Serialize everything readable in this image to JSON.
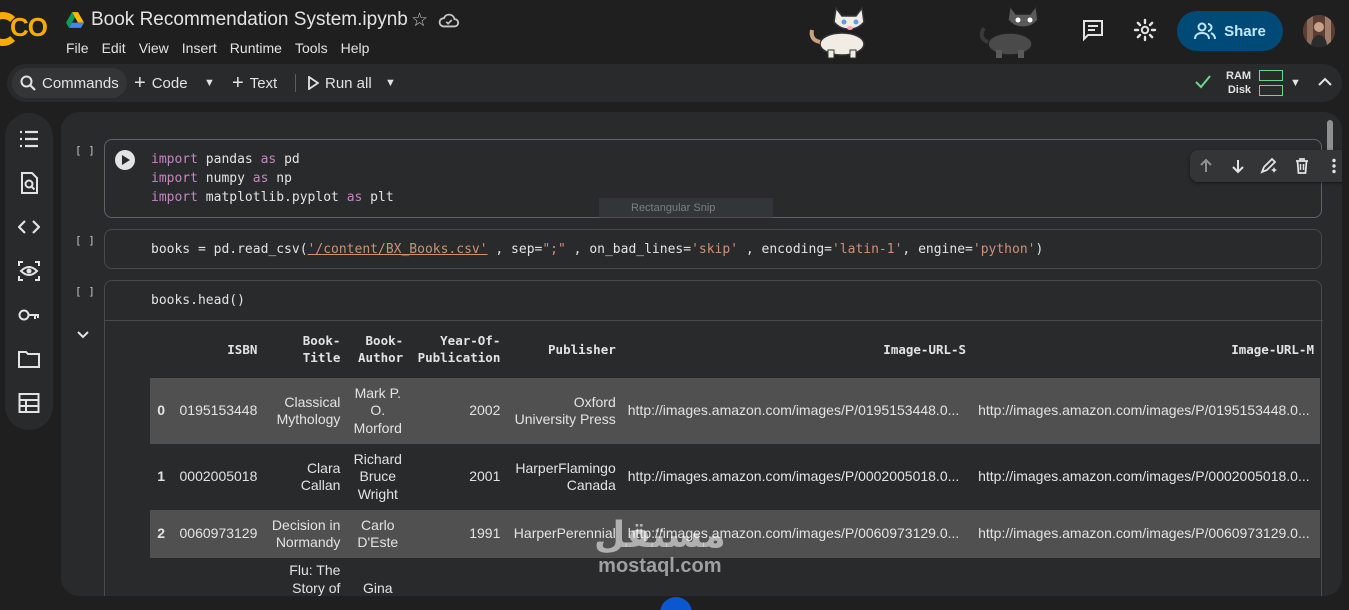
{
  "header": {
    "logo_text": "CO",
    "title": "Book Recommendation System.ipynb",
    "menu": [
      "File",
      "Edit",
      "View",
      "Insert",
      "Runtime",
      "Tools",
      "Help"
    ],
    "share_label": "Share"
  },
  "toolbar": {
    "commands_label": "Commands",
    "code_label": "Code",
    "text_label": "Text",
    "run_all_label": "Run all",
    "ram_label": "RAM",
    "disk_label": "Disk",
    "status_color": "#6dd58c"
  },
  "cells": [
    {
      "bracket": "[ ]",
      "lines": [
        [
          {
            "t": "import",
            "c": "kw"
          },
          {
            "t": " pandas ",
            "c": "plain"
          },
          {
            "t": "as",
            "c": "kw"
          },
          {
            "t": " pd",
            "c": "plain"
          }
        ],
        [
          {
            "t": "import",
            "c": "kw"
          },
          {
            "t": " numpy ",
            "c": "plain"
          },
          {
            "t": "as",
            "c": "kw"
          },
          {
            "t": " np",
            "c": "plain"
          }
        ],
        [
          {
            "t": "import",
            "c": "kw"
          },
          {
            "t": " matplotlib.pyplot ",
            "c": "plain"
          },
          {
            "t": "as",
            "c": "kw"
          },
          {
            "t": " plt",
            "c": "plain"
          }
        ]
      ]
    },
    {
      "bracket": "[ ]",
      "lines": [
        [
          {
            "t": "books = pd.read_csv(",
            "c": "plain"
          },
          {
            "t": "'/content/BX_Books.csv'",
            "c": "str-u"
          },
          {
            "t": " , sep=",
            "c": "plain"
          },
          {
            "t": "\";\"",
            "c": "str"
          },
          {
            "t": " , on_bad_lines=",
            "c": "plain"
          },
          {
            "t": "'skip'",
            "c": "str"
          },
          {
            "t": " , encoding=",
            "c": "plain"
          },
          {
            "t": "'latin-1'",
            "c": "str"
          },
          {
            "t": ", engine=",
            "c": "plain"
          },
          {
            "t": "'python'",
            "c": "str"
          },
          {
            "t": ")",
            "c": "plain"
          }
        ]
      ]
    },
    {
      "bracket": "[ ]",
      "lines": [
        [
          {
            "t": "books.head()",
            "c": "plain"
          }
        ]
      ]
    }
  ],
  "snip_label": "Rectangular Snip",
  "dataframe": {
    "columns": [
      {
        "key": "idx",
        "label": ""
      },
      {
        "key": "isbn",
        "label": "ISBN"
      },
      {
        "key": "title",
        "label": "Book-Title"
      },
      {
        "key": "author",
        "label": "Book-Author"
      },
      {
        "key": "year",
        "label": "Year-Of-Publication"
      },
      {
        "key": "publisher",
        "label": "Publisher"
      },
      {
        "key": "url_s",
        "label": "Image-URL-S"
      },
      {
        "key": "url_m",
        "label": "Image-URL-M"
      }
    ],
    "rows": [
      {
        "idx": "0",
        "isbn": "0195153448",
        "title": "Classical Mythology",
        "author": "Mark P. O. Morford",
        "year": "2002",
        "publisher": "Oxford University Press",
        "url_s": "http://images.amazon.com/images/P/0195153448.0...",
        "url_m": "http://images.amazon.com/images/P/0195153448.0..."
      },
      {
        "idx": "1",
        "isbn": "0002005018",
        "title": "Clara Callan",
        "author": "Richard Bruce Wright",
        "year": "2001",
        "publisher": "HarperFlamingo Canada",
        "url_s": "http://images.amazon.com/images/P/0002005018.0...",
        "url_m": "http://images.amazon.com/images/P/0002005018.0..."
      },
      {
        "idx": "2",
        "isbn": "0060973129",
        "title": "Decision in Normandy",
        "author": "Carlo D'Este",
        "year": "1991",
        "publisher": "HarperPerennial",
        "url_s": "http://images.amazon.com/images/P/0060973129.0...",
        "url_m": "http://images.amazon.com/images/P/0060973129.0..."
      },
      {
        "idx": "",
        "isbn": "",
        "title": "Flu: The Story of the",
        "author": "Gina",
        "year": "",
        "publisher": "",
        "url_s": "",
        "url_m": ""
      }
    ]
  },
  "watermark": {
    "arabic": "مستقل",
    "latin": "mostaql.com"
  }
}
